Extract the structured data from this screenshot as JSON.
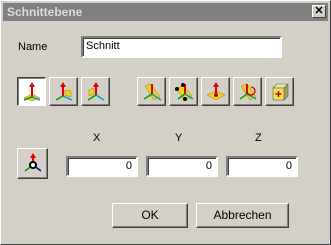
{
  "dialog": {
    "title": "Schnittebene",
    "close_glyph": "✕"
  },
  "name": {
    "label": "Name",
    "value": "Schnitt"
  },
  "toolbar": {
    "buttons": [
      {
        "icon": "plane-xy-icon",
        "selected": true
      },
      {
        "icon": "plane-xz-icon",
        "selected": false
      },
      {
        "icon": "plane-yz-icon",
        "selected": false
      },
      {
        "icon": "plane-diagonal-icon",
        "selected": false
      },
      {
        "icon": "plane-three-points-icon",
        "selected": false
      },
      {
        "icon": "plane-on-face-icon",
        "selected": false
      },
      {
        "icon": "plane-rotate-icon",
        "selected": false
      },
      {
        "icon": "plane-box-icon",
        "selected": false
      }
    ]
  },
  "coords": {
    "x_label": "X",
    "y_label": "Y",
    "z_label": "Z",
    "x_value": "0",
    "y_value": "0",
    "z_value": "0",
    "origin_icon": "origin-pick-icon"
  },
  "buttons": {
    "ok": "OK",
    "cancel": "Abbrechen"
  }
}
